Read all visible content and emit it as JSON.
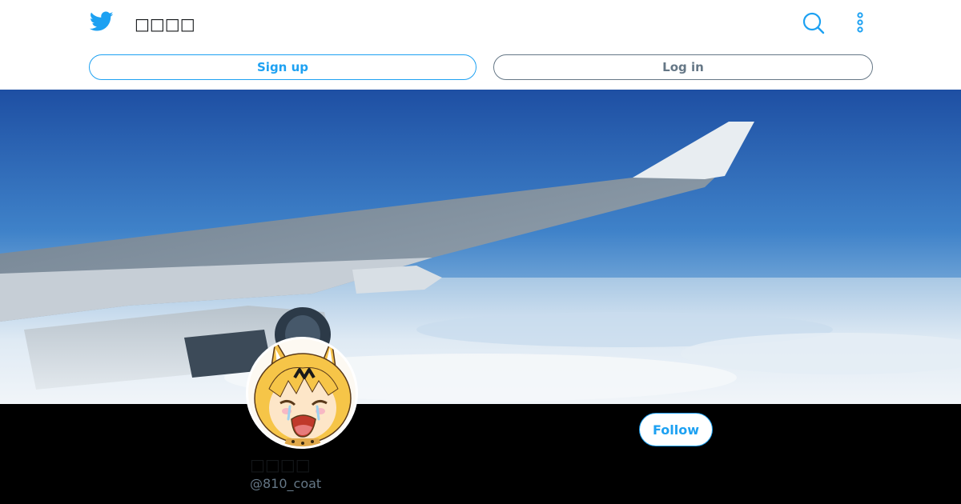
{
  "header": {
    "profile_name": "□□□□",
    "signup_label": "Sign up",
    "login_label": "Log in"
  },
  "profile": {
    "display_name": "□□□□",
    "screen_name": "@810_coat",
    "follow_label": "Follow"
  },
  "colors": {
    "brand": "#1da1f2",
    "muted": "#657786",
    "text": "#14171a",
    "background": "#000000"
  },
  "icons": {
    "logo": "twitter-bird-icon",
    "search": "search-icon",
    "more": "more-vertical-icon"
  }
}
